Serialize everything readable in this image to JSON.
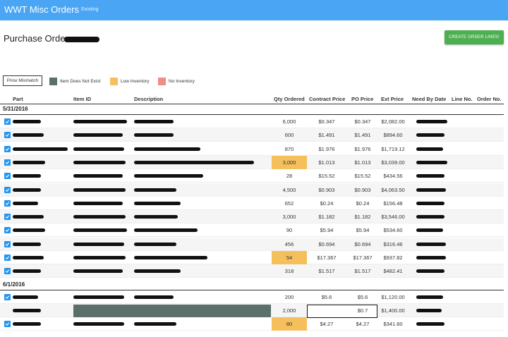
{
  "app": {
    "title": "WWT Misc Orders",
    "subtitle": "Existing"
  },
  "po": {
    "label": "Purchase Order:"
  },
  "actions": {
    "create_label": "CREATE ORDER LINES!"
  },
  "legend": [
    {
      "label": "Price Mismatch",
      "color": "#ffffff"
    },
    {
      "label": "Item Does Not Exist",
      "color": "#5b6f6b"
    },
    {
      "label": "Low Inventory",
      "color": "#f5c05b"
    },
    {
      "label": "No Inventory",
      "color": "#f28b82"
    }
  ],
  "columns": [
    "Part",
    "Item ID",
    "Description",
    "Qty Ordered",
    "Contract Price",
    "PO Price",
    "Ext Price",
    "Need By Date",
    "Line No.",
    "Order No."
  ],
  "groups": [
    {
      "date": "5/31/2016",
      "rows": [
        {
          "qty": "6,000",
          "contract": "$0.347",
          "po": "$0.347",
          "ext": "$2,082.00",
          "flag": "",
          "checked": true
        },
        {
          "qty": "600",
          "contract": "$1.491",
          "po": "$1.491",
          "ext": "$894.60",
          "flag": "",
          "checked": true
        },
        {
          "qty": "870",
          "contract": "$1.976",
          "po": "$1.976",
          "ext": "$1,719.12",
          "flag": "",
          "checked": true
        },
        {
          "qty": "3,000",
          "contract": "$1.013",
          "po": "$1.013",
          "ext": "$3,039.00",
          "flag": "low",
          "checked": true
        },
        {
          "qty": "28",
          "contract": "$15.52",
          "po": "$15.52",
          "ext": "$434.56",
          "flag": "",
          "checked": true
        },
        {
          "qty": "4,500",
          "contract": "$0.903",
          "po": "$0.903",
          "ext": "$4,063.50",
          "flag": "",
          "checked": true
        },
        {
          "qty": "652",
          "contract": "$0.24",
          "po": "$0.24",
          "ext": "$156.48",
          "flag": "",
          "checked": true
        },
        {
          "qty": "3,000",
          "contract": "$1.182",
          "po": "$1.182",
          "ext": "$3,546.00",
          "flag": "",
          "checked": true
        },
        {
          "qty": "90",
          "contract": "$5.94",
          "po": "$5.94",
          "ext": "$534.60",
          "flag": "",
          "checked": true
        },
        {
          "qty": "456",
          "contract": "$0.694",
          "po": "$0.694",
          "ext": "$316.46",
          "flag": "",
          "checked": true
        },
        {
          "qty": "54",
          "contract": "$17.367",
          "po": "$17.367",
          "ext": "$937.82",
          "flag": "low",
          "checked": true
        },
        {
          "qty": "318",
          "contract": "$1.517",
          "po": "$1.517",
          "ext": "$482.41",
          "flag": "",
          "checked": true
        }
      ]
    },
    {
      "date": "6/1/2016",
      "rows": [
        {
          "qty": "200",
          "contract": "$5.6",
          "po": "$5.6",
          "ext": "$1,120.00",
          "flag": "",
          "checked": true
        },
        {
          "qty": "2,000",
          "contract": "",
          "po": "$0.7",
          "ext": "$1,400.00",
          "flag": "missing",
          "checked": false
        },
        {
          "qty": "80",
          "contract": "$4.27",
          "po": "$4.27",
          "ext": "$341.60",
          "flag": "low",
          "checked": true
        }
      ]
    }
  ]
}
